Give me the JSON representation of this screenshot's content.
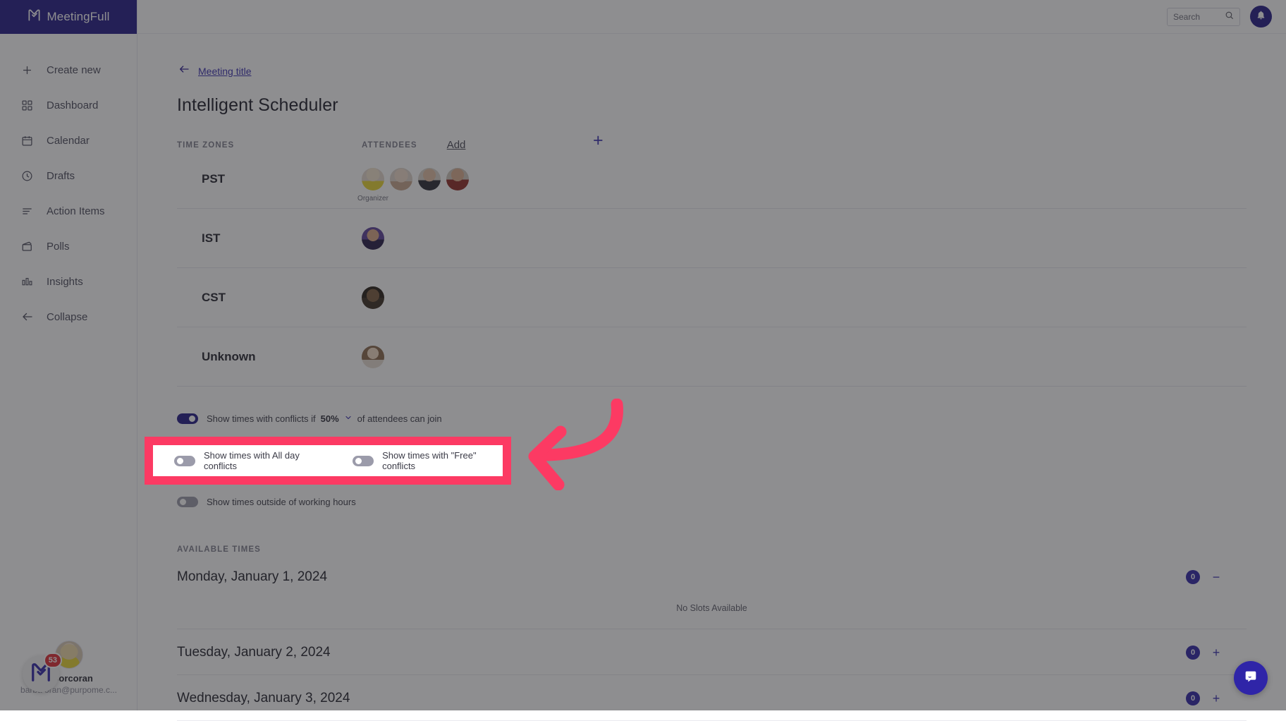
{
  "brand": {
    "name": "MeetingFull",
    "logo_icon": "meetingfull-check-logo",
    "color": "#231b86"
  },
  "sidebar": {
    "items": [
      {
        "label": "Create new",
        "icon": "plus-icon"
      },
      {
        "label": "Dashboard",
        "icon": "grid-icon"
      },
      {
        "label": "Calendar",
        "icon": "calendar-icon"
      },
      {
        "label": "Drafts",
        "icon": "clock-icon"
      },
      {
        "label": "Action Items",
        "icon": "list-icon"
      },
      {
        "label": "Polls",
        "icon": "poll-box-icon"
      },
      {
        "label": "Insights",
        "icon": "bar-chart-icon"
      },
      {
        "label": "Collapse",
        "icon": "arrow-left-icon"
      }
    ],
    "user": {
      "name": "a Corcoran",
      "email": "barba       oran@purpome.c...",
      "avatar_icon": "user-avatar"
    },
    "launcher": {
      "badge": "53",
      "icon": "meetingfull-launcher-logo"
    }
  },
  "topbar": {
    "search": {
      "placeholder": "Search",
      "value": "",
      "icon": "search-icon"
    },
    "notifications": {
      "icon": "bell-icon"
    }
  },
  "main": {
    "back_link": {
      "label": "Meeting title",
      "icon": "arrow-left-icon"
    },
    "page_title": "Intelligent Scheduler",
    "columns": {
      "time_zones_label": "TIME ZONES",
      "attendees_label": "ATTENDEES",
      "add_label": "Add",
      "add_plus_icon": "plus-icon"
    },
    "timezone_rows": [
      {
        "zone": "PST",
        "attendees": [
          {
            "label": "Organizer",
            "tone_a": "#f0dcc2",
            "tone_b": "#e9d531"
          },
          {
            "label": "",
            "tone_a": "#e9d8c8",
            "tone_b": "#c7a58c"
          },
          {
            "label": "",
            "tone_a": "#d9d3cb",
            "tone_b": "#2b2b33"
          },
          {
            "label": "",
            "tone_a": "#d8cfc8",
            "tone_b": "#8e2a24"
          }
        ]
      },
      {
        "zone": "IST",
        "attendees": [
          {
            "label": "",
            "tone_a": "#4b3a8c",
            "tone_b": "#2e2252"
          }
        ]
      },
      {
        "zone": "CST",
        "attendees": [
          {
            "label": "",
            "tone_a": "#2a2118",
            "tone_b": "#5c4530"
          }
        ]
      },
      {
        "zone": "Unknown",
        "attendees": [
          {
            "label": "",
            "tone_a": "#efe6dc",
            "tone_b": "#8a6a4c"
          }
        ]
      }
    ],
    "toggles": {
      "conflicts": {
        "state": "on",
        "text_before": "Show times with conflicts if",
        "percent": "50%",
        "caret_icon": "chevron-down-icon",
        "text_after": "of attendees can join"
      },
      "all_day": {
        "state": "off",
        "label": "Show times with All day conflicts"
      },
      "free": {
        "state": "off",
        "label": "Show times with \"Free\" conflicts"
      },
      "outside_hours": {
        "state": "off",
        "label": "Show times outside of working hours"
      }
    },
    "available_times": {
      "heading": "AVAILABLE TIMES",
      "days": [
        {
          "title": "Monday, January 1, 2024",
          "count": "0",
          "toggle_icon": "minus-icon",
          "empty_text": "No Slots Available",
          "expanded": true
        },
        {
          "title": "Tuesday, January 2, 2024",
          "count": "0",
          "toggle_icon": "plus-icon",
          "empty_text": "",
          "expanded": false
        },
        {
          "title": "Wednesday, January 3, 2024",
          "count": "0",
          "toggle_icon": "plus-icon",
          "empty_text": "",
          "expanded": false
        }
      ]
    }
  },
  "annotation": {
    "highlight_color": "#fc3a63",
    "arrow_icon": "curved-arrow-left",
    "target": "all-day-and-free-conflict-toggles"
  },
  "intercom": {
    "icon": "chat-bubble-icon"
  }
}
